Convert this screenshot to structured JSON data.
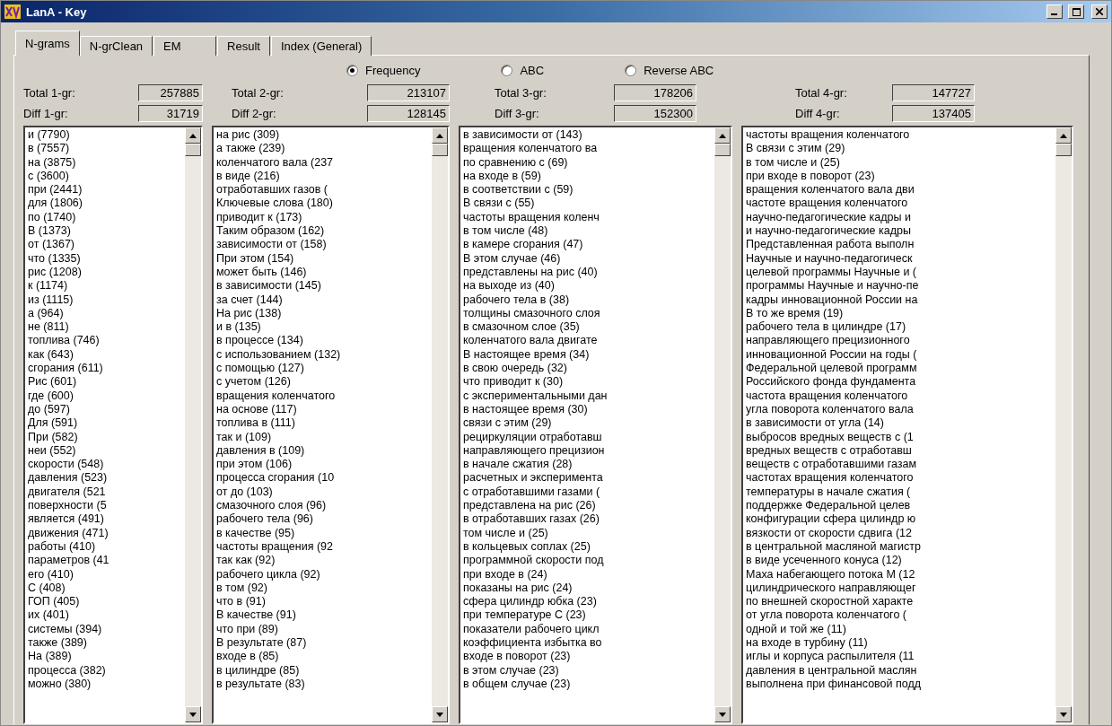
{
  "window": {
    "title": "LanA - Key"
  },
  "tabs": [
    {
      "label": "N-grams",
      "selected": true
    },
    {
      "label": "N-grClean",
      "selected": false
    },
    {
      "label": "EM",
      "selected": false
    },
    {
      "label": "Result",
      "selected": false
    },
    {
      "label": "Index (General)",
      "selected": false
    }
  ],
  "sort_options": [
    {
      "label": "Frequency",
      "selected": true
    },
    {
      "label": "ABC",
      "selected": false
    },
    {
      "label": "Reverse ABC",
      "selected": false
    }
  ],
  "columns": [
    {
      "total_label": "Total 1-gr:",
      "total_value": "257885",
      "diff_label": "Diff 1-gr:",
      "diff_value": "31719",
      "items": [
        "и (7790)",
        "в (7557)",
        "на (3875)",
        "с (3600)",
        "при (2441)",
        "для (1806)",
        "по (1740)",
        "В (1373)",
        "от (1367)",
        "что (1335)",
        "рис (1208)",
        "к (1174)",
        "из (1115)",
        "а (964)",
        "не (811)",
        "топлива (746)",
        "как (643)",
        "сгорания (611)",
        "Рис (601)",
        "где (600)",
        "до (597)",
        "Для (591)",
        "При (582)",
        "неи (552)",
        "скорости (548)",
        "давления (523)",
        "двигателя (521",
        "поверхности (5",
        "является (491)",
        "движения (471)",
        "работы (410)",
        "параметров (41",
        "его (410)",
        "С (408)",
        "ГОП (405)",
        "их (401)",
        "системы (394)",
        "также (389)",
        "На (389)",
        "процесса (382)",
        "можно (380)"
      ]
    },
    {
      "total_label": "Total 2-gr:",
      "total_value": "213107",
      "diff_label": "Diff 2-gr:",
      "diff_value": "128145",
      "items": [
        "на рис (309)",
        "а также (239)",
        "коленчатого вала (237",
        "в виде (216)",
        "отработавших газов (",
        "Ключевые слова (180)",
        "приводит к (173)",
        "Таким образом (162)",
        "зависимости от (158)",
        "При этом (154)",
        "может быть (146)",
        "в зависимости (145)",
        "за счет (144)",
        "На рис (138)",
        "и в (135)",
        "в процессе (134)",
        "с использованием (132)",
        "с помощью (127)",
        "с учетом (126)",
        "вращения коленчатого",
        "на основе (117)",
        "топлива в (111)",
        "так и (109)",
        "давления в (109)",
        "при этом (106)",
        "процесса сгорания (10",
        "от до (103)",
        "смазочного слоя (96)",
        "рабочего тела (96)",
        "в качестве (95)",
        "частоты вращения (92",
        "так как (92)",
        "рабочего цикла (92)",
        "в том (92)",
        "что в (91)",
        "В качестве (91)",
        "что при (89)",
        "В результате (87)",
        "входе в (85)",
        "в цилиндре (85)",
        "в результате (83)"
      ]
    },
    {
      "total_label": "Total 3-gr:",
      "total_value": "178206",
      "diff_label": "Diff 3-gr:",
      "diff_value": "152300",
      "items": [
        "в зависимости от (143)",
        "вращения коленчатого ва",
        "по сравнению с (69)",
        "на входе в (59)",
        "в соответствии с (59)",
        "В связи с (55)",
        "частоты вращения коленч",
        "в том числе (48)",
        "в камере сгорания (47)",
        "В этом случае (46)",
        "представлены на рис (40)",
        "на выходе из (40)",
        "рабочего тела в (38)",
        "толщины смазочного слоя",
        "в смазочном слое (35)",
        "коленчатого вала двигате",
        "В настоящее время (34)",
        "в свою очередь (32)",
        "что приводит к (30)",
        "с экспериментальными дан",
        "в настоящее время (30)",
        "связи с этим (29)",
        "рециркуляции отработавш",
        "направляющего прецизион",
        "в начале сжатия (28)",
        "расчетных и эксперимента",
        "с отработавшими газами (",
        "представлена на рис (26)",
        "в отработавших газах (26)",
        "том числе и (25)",
        "в кольцевых соплах (25)",
        "программной скорости под",
        "при входе в (24)",
        "показаны на рис (24)",
        "сфера цилиндр юбка (23)",
        "при температуре С (23)",
        "показатели рабочего цикл",
        "коэффициента избытка во",
        "входе в поворот (23)",
        "в этом случае (23)",
        "в общем случае (23)"
      ]
    },
    {
      "total_label": "Total 4-gr:",
      "total_value": "147727",
      "diff_label": "Diff 4-gr:",
      "diff_value": "137405",
      "items": [
        "частоты вращения коленчатого",
        "В связи с этим (29)",
        "в том числе и (25)",
        "при входе в поворот (23)",
        "вращения коленчатого вала дви",
        "частоте вращения коленчатого",
        "научно-педагогические кадры и",
        "и научно-педагогические кадры",
        "Представленная работа выполн",
        "Научные и научно-педагогическ",
        "целевой программы Научные и (",
        "программы Научные и научно-пе",
        "кадры инновационной России на",
        "В то же время (19)",
        "рабочего тела в цилиндре (17)",
        "направляющего прецизионного",
        "инновационной России на годы (",
        "Федеральной целевой программ",
        "Российского фонда фундамента",
        "частота вращения коленчатого",
        "угла поворота коленчатого вала",
        "в зависимости от угла (14)",
        "выбросов вредных веществ с (1",
        "вредных веществ с отработавш",
        "веществ с отработавшими газам",
        "частотах вращения коленчатого",
        "температуры в начале сжатия (",
        "поддержке Федеральной целев",
        "конфигурации сфера цилиндр ю",
        "вязкости от скорости сдвига (12",
        "в центральной масляной магистр",
        "в виде усеченного конуса (12)",
        "Маха набегающего потока М (12",
        "цилиндрического направляющег",
        "по внешней скоростной характе",
        "от угла поворота коленчатого (",
        "одной и той же (11)",
        "на входе в турбину (11)",
        "иглы и корпуса распылителя (11",
        "давления в центральной маслян",
        "выполнена при финансовой подд"
      ]
    }
  ]
}
